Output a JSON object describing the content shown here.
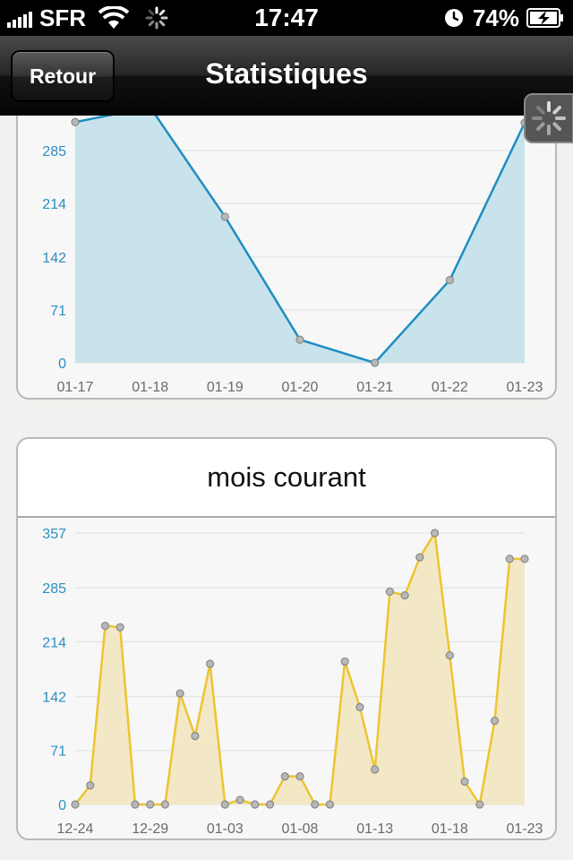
{
  "status_bar": {
    "carrier": "SFR",
    "time": "17:47",
    "battery_percent": "74%"
  },
  "nav": {
    "back_label": "Retour",
    "title": "Statistiques"
  },
  "charts": {
    "second_title": "mois courant"
  },
  "colors": {
    "blue_line": "#1e8ec0",
    "blue_fill": "#c9e3ec",
    "yellow_line": "#ecc531",
    "yellow_fill": "#f3e8c5",
    "tick_label": "#2a8fc0",
    "x_tick_label": "#6a6a6a"
  },
  "chart_data": [
    {
      "type": "area",
      "title": "",
      "x": [
        "01-17",
        "01-18",
        "01-19",
        "01-20",
        "01-21",
        "01-22",
        "01-23"
      ],
      "xticks": [
        "01-17",
        "01-18",
        "01-19",
        "01-20",
        "01-21",
        "01-22",
        "01-23"
      ],
      "yticks": [
        0,
        71,
        142,
        214,
        285
      ],
      "ylim": [
        0,
        357
      ],
      "series": [
        {
          "values": [
            323,
            343,
            196,
            31,
            0,
            111,
            322
          ]
        }
      ]
    },
    {
      "type": "area",
      "title": "mois courant",
      "x": [
        "12-24",
        "12-25",
        "12-26",
        "12-27",
        "12-28",
        "12-29",
        "12-30",
        "12-31",
        "01-01",
        "01-02",
        "01-03",
        "01-04",
        "01-05",
        "01-06",
        "01-07",
        "01-08",
        "01-09",
        "01-10",
        "01-11",
        "01-12",
        "01-13",
        "01-14",
        "01-15",
        "01-16",
        "01-17",
        "01-18",
        "01-19",
        "01-20",
        "01-21",
        "01-22",
        "01-23"
      ],
      "xticks": [
        "12-24",
        "12-29",
        "01-03",
        "01-08",
        "01-13",
        "01-18",
        "01-23"
      ],
      "yticks": [
        0,
        71,
        142,
        214,
        285,
        357
      ],
      "ylim": [
        0,
        357
      ],
      "series": [
        {
          "values": [
            0,
            25,
            235,
            233,
            0,
            0,
            0,
            146,
            90,
            185,
            0,
            6,
            0,
            0,
            37,
            37,
            0,
            0,
            188,
            128,
            46,
            280,
            275,
            325,
            357,
            196,
            30,
            0,
            110,
            323,
            323
          ]
        }
      ]
    }
  ]
}
